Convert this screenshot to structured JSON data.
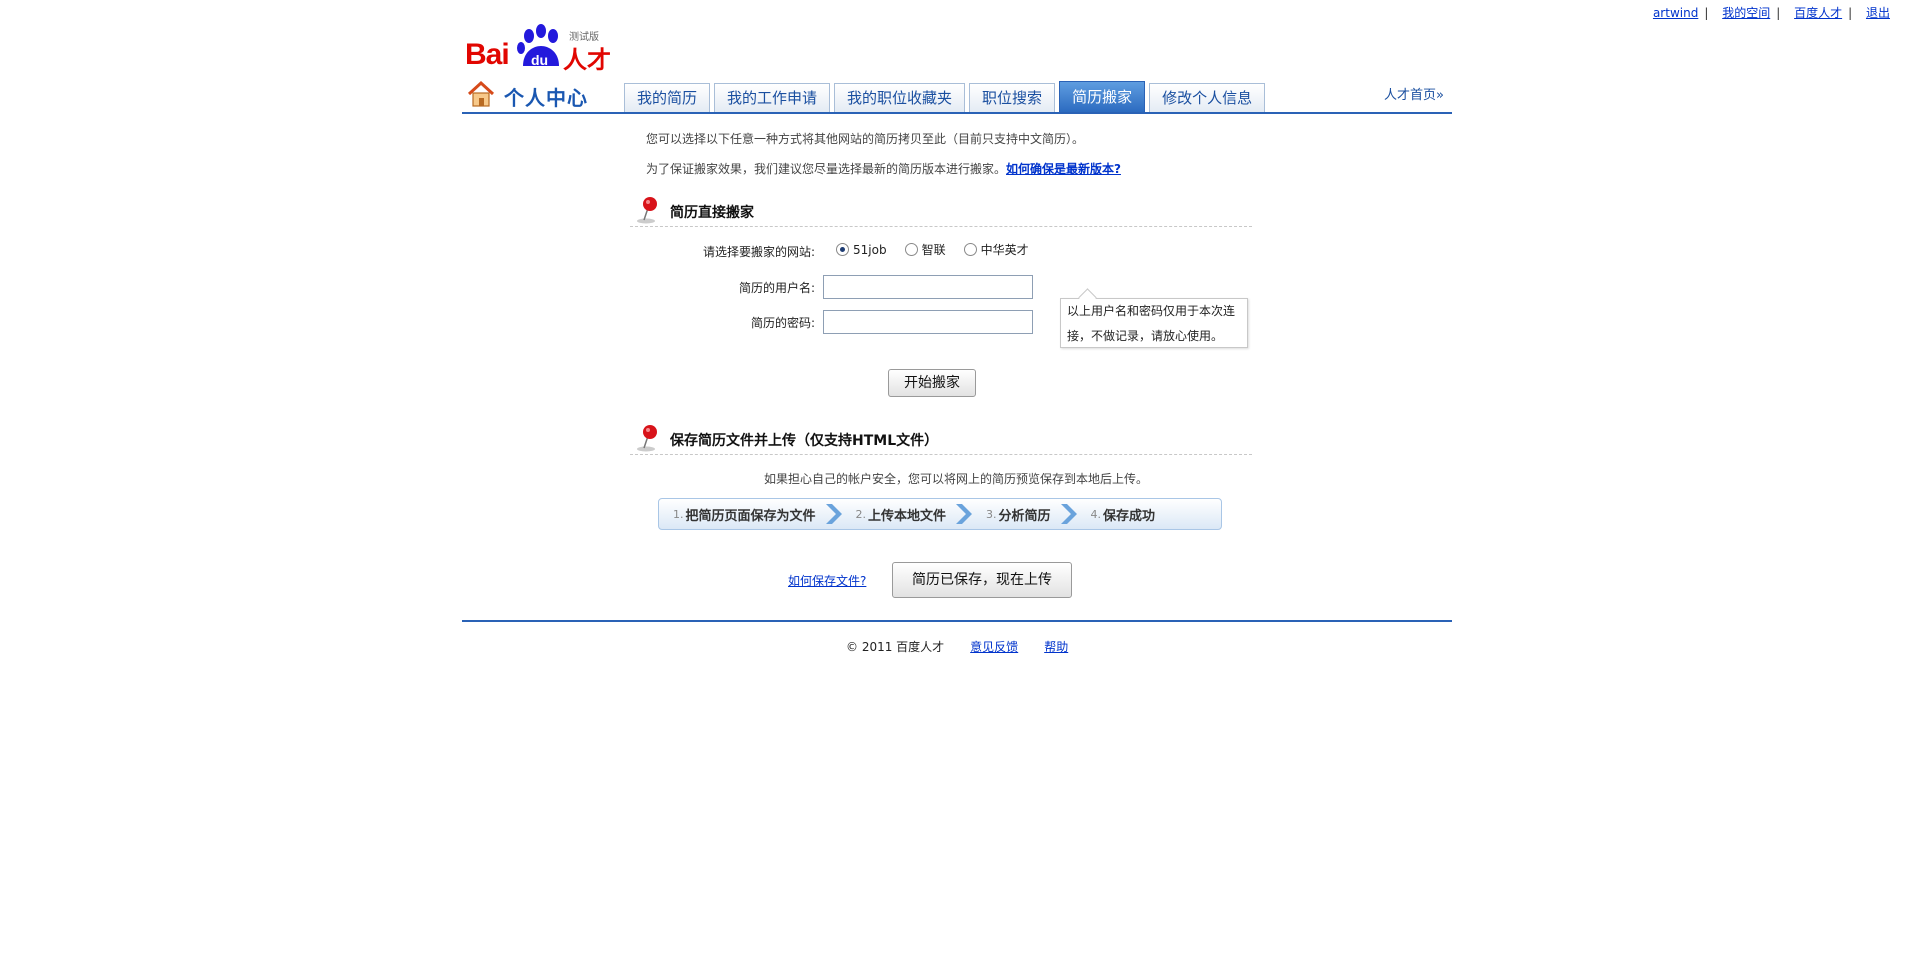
{
  "top_links": {
    "user": "artwind",
    "space": "我的空间",
    "baidu_rencai": "百度人才",
    "logout": "退出"
  },
  "logo": {
    "bai": "Bai",
    "du": "du",
    "rencai": "人才",
    "beta": "测试版"
  },
  "nav": {
    "center_title": "个人中心",
    "tabs": [
      "我的简历",
      "我的工作申请",
      "我的职位收藏夹",
      "职位搜索",
      "简历搬家",
      "修改个人信息"
    ],
    "active_tab": "简历搬家",
    "home_link": "人才首页»"
  },
  "intro": {
    "line1": "您可以选择以下任意一种方式将其他网站的简历拷贝至此（目前只支持中文简历）。",
    "line2": "为了保证搬家效果，我们建议您尽量选择最新的简历版本进行搬家。",
    "line2_link": "如何确保是最新版本?"
  },
  "section1": {
    "title": "简历直接搬家",
    "site_label": "请选择要搬家的网站:",
    "sites": [
      "51job",
      "智联",
      "中华英才"
    ],
    "selected_site": "51job",
    "username_label": "简历的用户名:",
    "username_value": "",
    "password_label": "简历的密码:",
    "password_value": "",
    "tooltip_line1": "以上用户名和密码仅用于本次连",
    "tooltip_line2": "接，不做记录，请放心使用。",
    "start_button": "开始搬家"
  },
  "section2": {
    "title": "保存简历文件并上传（仅支持HTML文件）",
    "desc": "如果担心自己的帐户安全，您可以将网上的简历预览保存到本地后上传。",
    "steps": [
      {
        "num": "1.",
        "label": "把简历页面保存为文件"
      },
      {
        "num": "2.",
        "label": "上传本地文件"
      },
      {
        "num": "3.",
        "label": "分析简历"
      },
      {
        "num": "4.",
        "label": "保存成功"
      }
    ],
    "how_link": "如何保存文件?",
    "upload_button": "简历已保存，现在上传"
  },
  "footer": {
    "copyright": "© 2011 百度人才",
    "feedback": "意见反馈",
    "help": "帮助"
  },
  "colors": {
    "brand_red": "#e10601",
    "brand_blue": "#2a62b6",
    "link": "#0033cc"
  }
}
